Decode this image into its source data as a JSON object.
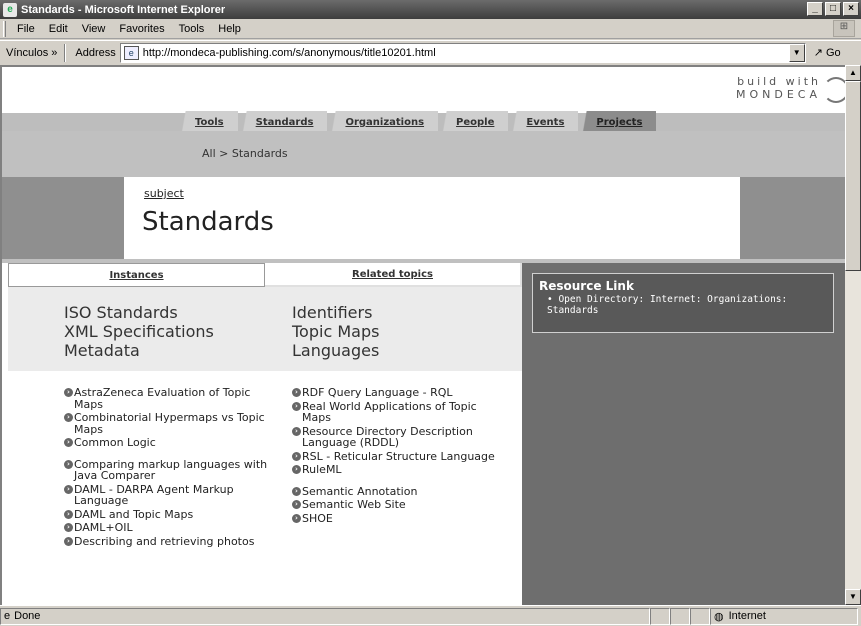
{
  "window": {
    "title": "Standards - Microsoft Internet Explorer"
  },
  "menu": [
    "File",
    "Edit",
    "View",
    "Favorites",
    "Tools",
    "Help"
  ],
  "addressbar": {
    "links_label": "Vínculos",
    "address_label": "Address",
    "url": "http://mondeca-publishing.com/s/anonymous/title10201.html",
    "go_label": "Go"
  },
  "page": {
    "brand_line1": "build with",
    "brand_line2": "MONDECA",
    "tabs": [
      "Tools",
      "Standards",
      "Organizations",
      "People",
      "Events",
      "Projects"
    ],
    "breadcrumb": "All > Standards",
    "subject_link": "subject",
    "title": "Standards",
    "view_tabs": [
      "Instances",
      "Related topics"
    ],
    "categories_left": [
      "ISO Standards",
      "XML Specifications",
      "Metadata"
    ],
    "categories_right": [
      "Identifiers",
      "Topic Maps",
      "Languages"
    ],
    "list_left": [
      "AstraZeneca Evaluation of Topic Maps",
      "Combinatorial Hypermaps vs Topic Maps",
      "Common Logic",
      "Comparing markup languages with Java Comparer",
      "DAML - DARPA Agent Markup Language",
      "DAML and Topic Maps",
      "DAML+OIL",
      "Describing and retrieving photos"
    ],
    "list_right": [
      "RDF Query Language - RQL",
      "Real World Applications of Topic Maps",
      "Resource Directory Description Language (RDDL)",
      "RSL - Reticular Structure Language",
      "RuleML",
      "Semantic Annotation",
      "Semantic Web Site",
      "SHOE"
    ],
    "resource_link_heading": "Resource Link",
    "resource_link_item": "Open Directory: Internet: Organizations: Standards"
  },
  "status": {
    "text": "Done",
    "zone": "Internet"
  }
}
